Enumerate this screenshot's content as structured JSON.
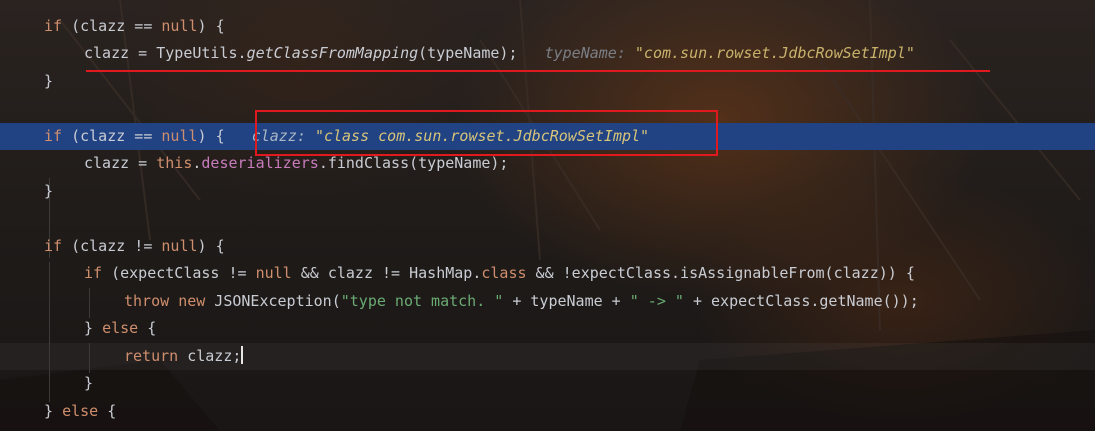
{
  "editor": {
    "language": "java",
    "lines": [
      {
        "id": "l1",
        "tokens": [
          {
            "t": "if",
            "c": "kw"
          },
          {
            "t": " (clazz == "
          },
          {
            "t": "null",
            "c": "kw"
          },
          {
            "t": ") {"
          }
        ]
      },
      {
        "id": "l2",
        "tokens": [
          {
            "t": "clazz = TypeUtils."
          },
          {
            "t": "getClassFromMapping",
            "c": "it"
          },
          {
            "t": "(typeName);"
          }
        ],
        "hint": {
          "name": "typeName:",
          "value": "\"com.sun.rowset.JdbcRowSetImpl\""
        }
      },
      {
        "id": "l3",
        "tokens": [
          {
            "t": "}"
          }
        ]
      },
      {
        "id": "l4",
        "tokens": []
      },
      {
        "id": "l5",
        "tokens": [
          {
            "t": "if",
            "c": "kw"
          },
          {
            "t": " (clazz == "
          },
          {
            "t": "null",
            "c": "kw"
          },
          {
            "t": ") {"
          }
        ],
        "hint": {
          "name": "clazz:",
          "value": "\"class com.sun.rowset.JdbcRowSetImpl\""
        }
      },
      {
        "id": "l6",
        "tokens": [
          {
            "t": "clazz = "
          },
          {
            "t": "this",
            "c": "kw"
          },
          {
            "t": "."
          },
          {
            "t": "deserializers",
            "c": "fld"
          },
          {
            "t": ".findClass(typeName);"
          }
        ]
      },
      {
        "id": "l7",
        "tokens": [
          {
            "t": "}"
          }
        ]
      },
      {
        "id": "l8",
        "tokens": []
      },
      {
        "id": "l9",
        "tokens": [
          {
            "t": "if",
            "c": "kw"
          },
          {
            "t": " (clazz != "
          },
          {
            "t": "null",
            "c": "kw"
          },
          {
            "t": ") {"
          }
        ]
      },
      {
        "id": "l10",
        "tokens": [
          {
            "t": "if",
            "c": "kw"
          },
          {
            "t": " (expectClass != "
          },
          {
            "t": "null",
            "c": "kw"
          },
          {
            "t": " && clazz != HashMap."
          },
          {
            "t": "class",
            "c": "kw"
          },
          {
            "t": " && !expectClass.isAssignableFrom(clazz)) {"
          }
        ]
      },
      {
        "id": "l11",
        "tokens": [
          {
            "t": "throw",
            "c": "kw"
          },
          {
            "t": " "
          },
          {
            "t": "new",
            "c": "kw"
          },
          {
            "t": " JSONException("
          },
          {
            "t": "\"type not match. \"",
            "c": "str"
          },
          {
            "t": " + typeName + "
          },
          {
            "t": "\" -> \"",
            "c": "str"
          },
          {
            "t": " + expectClass.getName());"
          }
        ]
      },
      {
        "id": "l12",
        "tokens": [
          {
            "t": "} "
          },
          {
            "t": "else",
            "c": "kw"
          },
          {
            "t": " {"
          }
        ]
      },
      {
        "id": "l13",
        "tokens": [
          {
            "t": "return",
            "c": "kw"
          },
          {
            "t": " clazz;"
          }
        ]
      },
      {
        "id": "l14",
        "tokens": [
          {
            "t": "}"
          }
        ]
      },
      {
        "id": "l15",
        "tokens": [
          {
            "t": "} "
          },
          {
            "t": "else",
            "c": "kw"
          },
          {
            "t": " {"
          }
        ]
      }
    ]
  },
  "colors": {
    "keyword": "#cf8e6d",
    "field": "#c77dbb",
    "string": "#6aab73",
    "current_line": "#214283",
    "annotation": "#e0191e"
  }
}
